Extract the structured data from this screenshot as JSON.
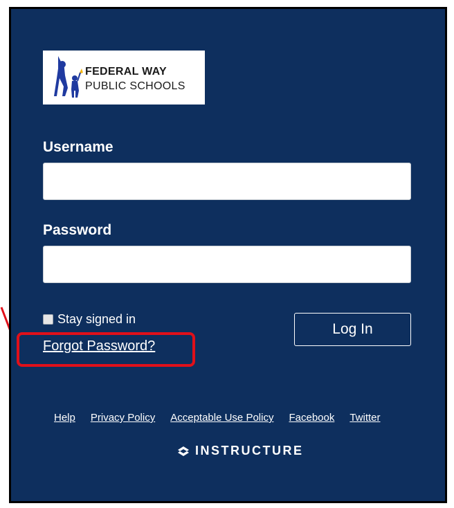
{
  "logo": {
    "line1": "FEDERAL WAY",
    "line2": "PUBLIC SCHOOLS",
    "icon": "school-figures-logo"
  },
  "form": {
    "username_label": "Username",
    "username_value": "",
    "password_label": "Password",
    "password_value": "",
    "stay_signed_in_label": "Stay signed in",
    "stay_signed_in_checked": false,
    "login_label": "Log In",
    "forgot_label": "Forgot Password?"
  },
  "footer": {
    "links": [
      "Help",
      "Privacy Policy",
      "Acceptable Use Policy",
      "Facebook",
      "Twitter"
    ],
    "brand": "INSTRUCTURE",
    "brand_icon": "instructure-logo-icon"
  },
  "colors": {
    "panel_bg": "#0e2f5e",
    "highlight": "#e0101a",
    "text": "#ffffff"
  }
}
